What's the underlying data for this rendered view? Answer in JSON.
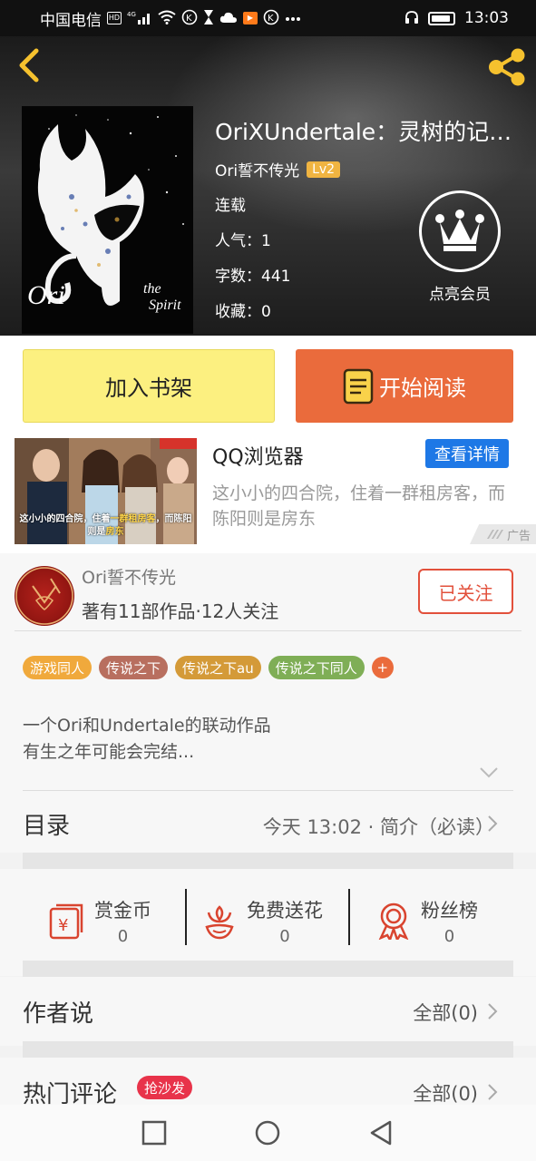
{
  "status_bar": {
    "carrier": "中国电信",
    "hd": "HD",
    "network": "4G",
    "time": "13:03"
  },
  "book": {
    "title": "OriXUndertale：灵树的记…",
    "author": "Ori誓不传光",
    "level": "Lv2",
    "status": "连载",
    "popularity_label": "人气：",
    "popularity": "1",
    "words_label": "字数：",
    "words": "441",
    "favorites_label": "收藏：",
    "favorites": "0",
    "cover_text_left": "Ori",
    "cover_text_right_1": "the",
    "cover_text_right_2": "Spirit"
  },
  "vip": {
    "label": "点亮会员",
    "icon": "crown-icon"
  },
  "actions": {
    "add_shelf": "加入书架",
    "start_read": "开始阅读"
  },
  "ad": {
    "title": "QQ浏览器",
    "button": "查看详情",
    "description": "这小小的四合院，住着一群租房客，而陈阳则是房东",
    "image_caption_1a": "这小小的四合院，住着",
    "image_caption_1b": "一群租房客",
    "image_caption_1c": "，而陈阳",
    "image_caption_2a": "则是",
    "image_caption_2b": "房东",
    "tag": "广告"
  },
  "author_card": {
    "name": "Ori誓不传光",
    "stats": "著有11部作品·12人关注",
    "follow": "已关注"
  },
  "tags": [
    {
      "label": "游戏同人",
      "color": "#f0a93c"
    },
    {
      "label": "传说之下",
      "color": "#b86f5f"
    },
    {
      "label": "传说之下au",
      "color": "#d49a38"
    },
    {
      "label": "传说之下同人",
      "color": "#7fae56"
    }
  ],
  "tag_more": "+",
  "description": {
    "line1": "一个Ori和Undertale的联动作品",
    "line2": "有生之年可能会完结..."
  },
  "toc": {
    "label": "目录",
    "info": "今天 13:02 · 简介（必读）"
  },
  "rewards": [
    {
      "label": "赏金币",
      "count": "0",
      "icon": "gold-coin-icon"
    },
    {
      "label": "免费送花",
      "count": "0",
      "icon": "flower-icon"
    },
    {
      "label": "粉丝榜",
      "count": "0",
      "icon": "medal-icon"
    }
  ],
  "author_says": {
    "label": "作者说",
    "right": "全部(0)"
  },
  "hot_comments": {
    "label": "热门评论",
    "badge": "抢沙发",
    "right": "全部(0)"
  },
  "colors": {
    "accent_orange": "#ea6b3c",
    "shelf_yellow": "#fcf080",
    "follow_red": "#e2503b",
    "ad_blue": "#1e78e6",
    "level_gold": "#f0b441"
  }
}
